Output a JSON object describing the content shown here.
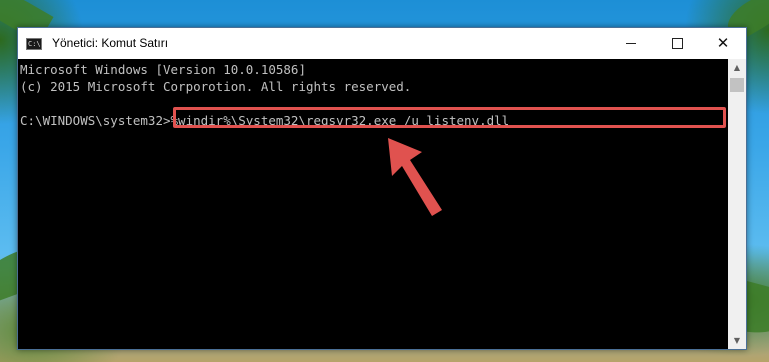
{
  "window": {
    "title": "Yönetici: Komut Satırı",
    "icon": "cmd-icon"
  },
  "controls": {
    "minimize": "minimize-icon",
    "maximize": "maximize-icon",
    "close": "close-icon"
  },
  "console": {
    "line1": "Microsoft Windows [Version 10.0.10586]",
    "line2": "(c) 2015 Microsoft Corporotion. All rights reserved.",
    "prompt": "C:\\WINDOWS\\system32>",
    "command": "%windir%\\System32\\regsvr32.exe /u listenv.dll"
  },
  "colors": {
    "highlight_border": "#e0524f",
    "arrow": "#e0524f",
    "console_bg": "#000000",
    "console_text": "#c0c0c0"
  }
}
